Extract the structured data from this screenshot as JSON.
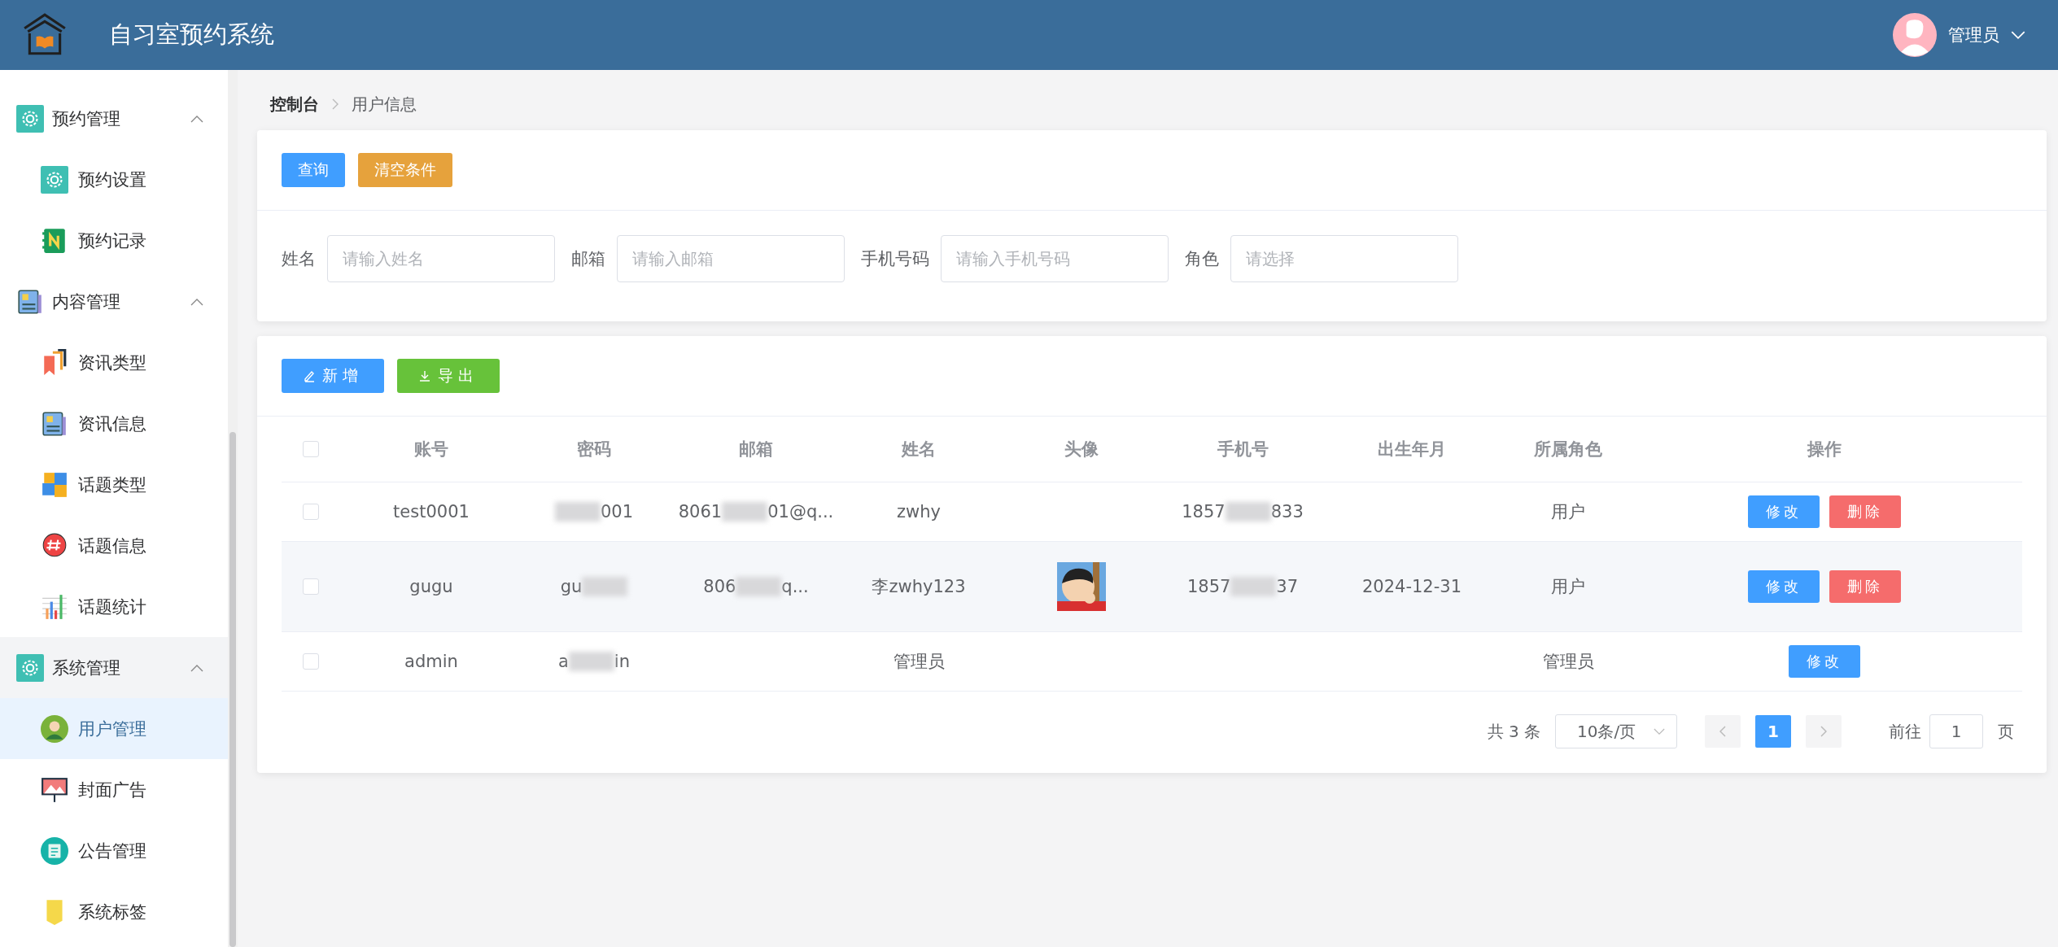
{
  "header": {
    "title": "自习室预约系统",
    "user": "管理员"
  },
  "sidebar": {
    "items": [
      {
        "label": "预约管理",
        "expanded": true,
        "active": false,
        "children": [
          {
            "label": "预约设置",
            "selected": false
          },
          {
            "label": "预约记录",
            "selected": false
          }
        ]
      },
      {
        "label": "内容管理",
        "expanded": true,
        "active": false,
        "children": [
          {
            "label": "资讯类型",
            "selected": false
          },
          {
            "label": "资讯信息",
            "selected": false
          },
          {
            "label": "话题类型",
            "selected": false
          },
          {
            "label": "话题信息",
            "selected": false
          },
          {
            "label": "话题统计",
            "selected": false
          }
        ]
      },
      {
        "label": "系统管理",
        "expanded": true,
        "active": true,
        "children": [
          {
            "label": "用户管理",
            "selected": true
          },
          {
            "label": "封面广告",
            "selected": false
          },
          {
            "label": "公告管理",
            "selected": false
          },
          {
            "label": "系统标签",
            "selected": false
          }
        ]
      }
    ]
  },
  "breadcrumb": [
    "控制台",
    "用户信息"
  ],
  "search": {
    "buttons": [
      {
        "kind": "primary",
        "label": "查询"
      },
      {
        "kind": "warning",
        "label": "清空条件"
      }
    ],
    "fields": [
      {
        "label": "姓名",
        "placeholder": "请输入姓名"
      },
      {
        "label": "邮箱",
        "placeholder": "请输入邮箱"
      },
      {
        "label": "手机号码",
        "placeholder": "请输入手机号码"
      },
      {
        "label": "角色",
        "placeholder": "请选择"
      }
    ]
  },
  "toolbar": {
    "buttons": [
      {
        "kind": "add",
        "label": "新增"
      },
      {
        "kind": "export",
        "label": "导出"
      }
    ]
  },
  "table": {
    "header_checked": false,
    "columns": [
      "账号",
      "密码",
      "邮箱",
      "姓名",
      "头像",
      "手机号",
      "出生年月",
      "所属角色",
      "操作"
    ],
    "rows": [
      {
        "checked": false,
        "hovered": false,
        "account": "test0001",
        "password": {
          "after": "001"
        },
        "email": {
          "before": "8061",
          "after": "01@q..."
        },
        "name": "zwhy",
        "phone": {
          "before": "1857",
          "after": "833"
        },
        "role": "用户",
        "actions": [
          {
            "kind": "edit",
            "label": "修改"
          },
          {
            "kind": "delete",
            "label": "删除"
          }
        ]
      },
      {
        "checked": false,
        "hovered": true,
        "account": "gugu",
        "password": {
          "before": "gu"
        },
        "email": {
          "before": "806",
          "after": "q..."
        },
        "name": "李zwhy123",
        "avatar": {
          "kind": "picture"
        },
        "phone": {
          "before": "1857",
          "after": "37"
        },
        "birth": "2024-12-31",
        "role": "用户",
        "actions": [
          {
            "kind": "edit",
            "label": "修改"
          },
          {
            "kind": "delete",
            "label": "删除"
          }
        ]
      },
      {
        "checked": false,
        "hovered": false,
        "account": "admin",
        "password": {
          "before": "a",
          "after": "in"
        },
        "name": "管理员",
        "role": "管理员",
        "actions": [
          {
            "kind": "edit",
            "label": "修改"
          }
        ]
      }
    ]
  },
  "pagination": {
    "total": "共 3 条",
    "page_size": "10条/页",
    "pages": [
      {
        "label": "1",
        "selected": true
      }
    ],
    "goto_label": "前往",
    "goto_value": "1",
    "goto_suffix": "页"
  }
}
